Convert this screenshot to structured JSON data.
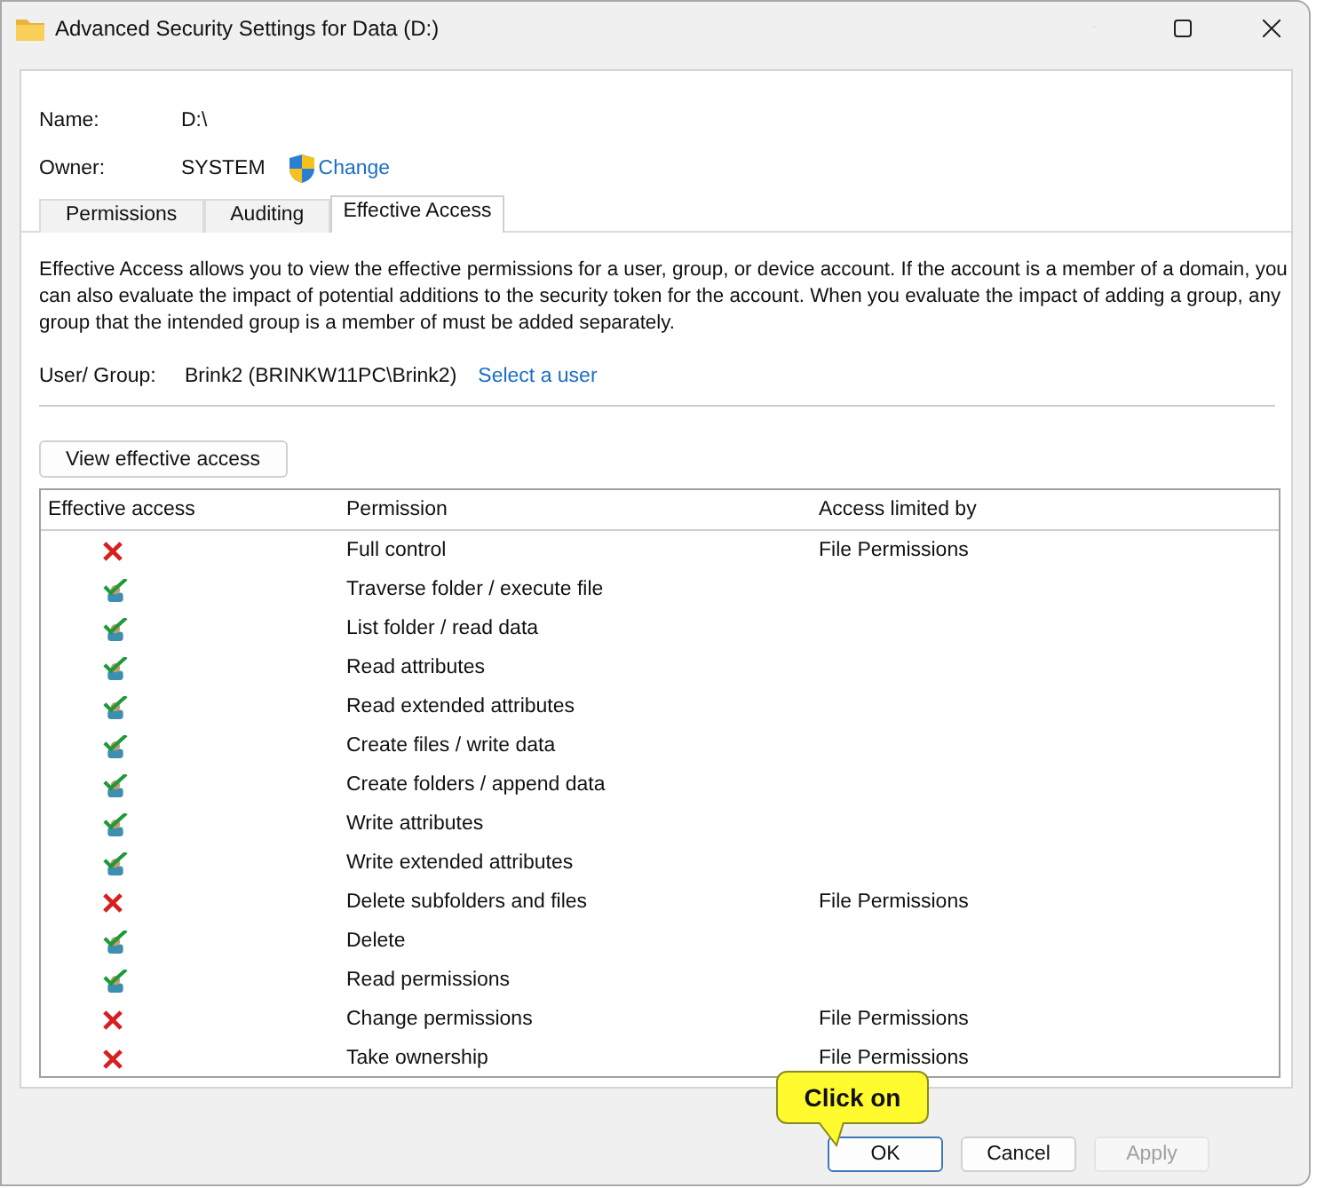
{
  "window": {
    "title": "Advanced Security Settings for Data (D:)"
  },
  "name": {
    "label": "Name:",
    "value": "D:\\"
  },
  "owner": {
    "label": "Owner:",
    "value": "SYSTEM",
    "link": "Change"
  },
  "tabs": [
    {
      "label": "Permissions",
      "selected": false
    },
    {
      "label": "Auditing",
      "selected": false
    },
    {
      "label": "Effective Access",
      "selected": true
    }
  ],
  "description": "Effective Access allows you to view the effective permissions for a user, group, or device account. If the account is a member of a domain, you can also evaluate the impact of potential additions to the security token for the account. When you evaluate the impact of adding a group, any group that the intended group is a member of must be added separately.",
  "user_group": {
    "label": "User/ Group:",
    "value": "Brink2 (BRINKW11PC\\Brink2)",
    "link": "Select a user"
  },
  "view_button": "View effective access",
  "table": {
    "columns": [
      "Effective access",
      "Permission",
      "Access limited by"
    ],
    "rows": [
      {
        "allowed": false,
        "permission": "Full control",
        "limited_by": "File Permissions"
      },
      {
        "allowed": true,
        "permission": "Traverse folder / execute file"
      },
      {
        "allowed": true,
        "permission": "List folder / read data"
      },
      {
        "allowed": true,
        "permission": "Read attributes"
      },
      {
        "allowed": true,
        "permission": "Read extended attributes"
      },
      {
        "allowed": true,
        "permission": "Create files / write data"
      },
      {
        "allowed": true,
        "permission": "Create folders / append data"
      },
      {
        "allowed": true,
        "permission": "Write attributes"
      },
      {
        "allowed": true,
        "permission": "Write extended attributes"
      },
      {
        "allowed": false,
        "permission": "Delete subfolders and files",
        "limited_by": "File Permissions"
      },
      {
        "allowed": true,
        "permission": "Delete"
      },
      {
        "allowed": true,
        "permission": "Read permissions"
      },
      {
        "allowed": false,
        "permission": "Change permissions",
        "limited_by": "File Permissions"
      },
      {
        "allowed": false,
        "permission": "Take ownership",
        "limited_by": "File Permissions"
      }
    ]
  },
  "buttons": [
    {
      "label": "OK",
      "disabled": false,
      "default": true
    },
    {
      "label": "Cancel",
      "disabled": false,
      "default": false
    },
    {
      "label": "Apply",
      "disabled": true,
      "default": false
    }
  ],
  "callout": "Click on"
}
